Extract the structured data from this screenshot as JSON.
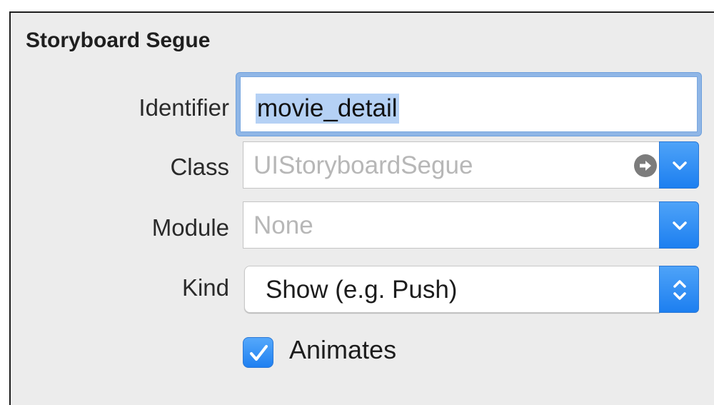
{
  "section": {
    "title": "Storyboard Segue"
  },
  "fields": {
    "identifier": {
      "label": "Identifier",
      "value": "movie_detail"
    },
    "class": {
      "label": "Class",
      "placeholder": "UIStoryboardSegue"
    },
    "module": {
      "label": "Module",
      "placeholder": "None"
    },
    "kind": {
      "label": "Kind",
      "value": "Show (e.g. Push)"
    },
    "animates": {
      "label": "Animates",
      "checked": true
    }
  },
  "icons": {
    "class_arrow": "arrow-right-circle-icon",
    "class_dropdown": "chevron-down-icon",
    "module_dropdown": "chevron-down-icon",
    "kind_stepper": "chevron-up-down-icon",
    "animates_check": "checkmark-icon"
  },
  "colors": {
    "accent": "#1d7ff0",
    "focus_ring": "#8fb6e6",
    "selection": "#b5d1f5"
  }
}
